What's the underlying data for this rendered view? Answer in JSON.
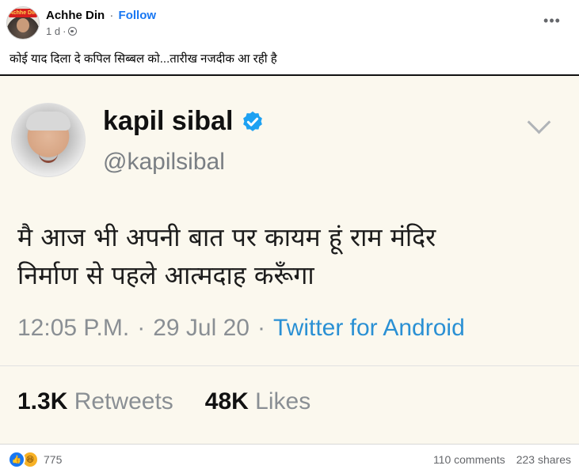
{
  "post": {
    "author": "Achhe Din",
    "follow_label": "Follow",
    "separator": "·",
    "time": "1 d",
    "more_label": "•••",
    "avatar_badge": "Achhe Din",
    "caption": "कोई याद दिला दे कपिल सिब्बल को...तारीख नजदीक आ रही है"
  },
  "tweet": {
    "name": "kapil sibal",
    "handle": "@kapilsibal",
    "text_line1": "मै आज भी अपनी बात पर कायम हूं राम मंदिर",
    "text_line2": "निर्माण से पहले आत्मदाह करूँगा",
    "time": "12:05 P.M.",
    "dot1": "·",
    "date": "29 Jul 20",
    "dot2": "·",
    "source": "Twitter for Android",
    "retweets_count": "1.3K",
    "retweets_label": "Retweets",
    "likes_count": "48K",
    "likes_label": "Likes",
    "verified_color": "#1da1f2"
  },
  "footer": {
    "reactions_count": "775",
    "comments": "110 comments",
    "shares": "223 shares"
  }
}
